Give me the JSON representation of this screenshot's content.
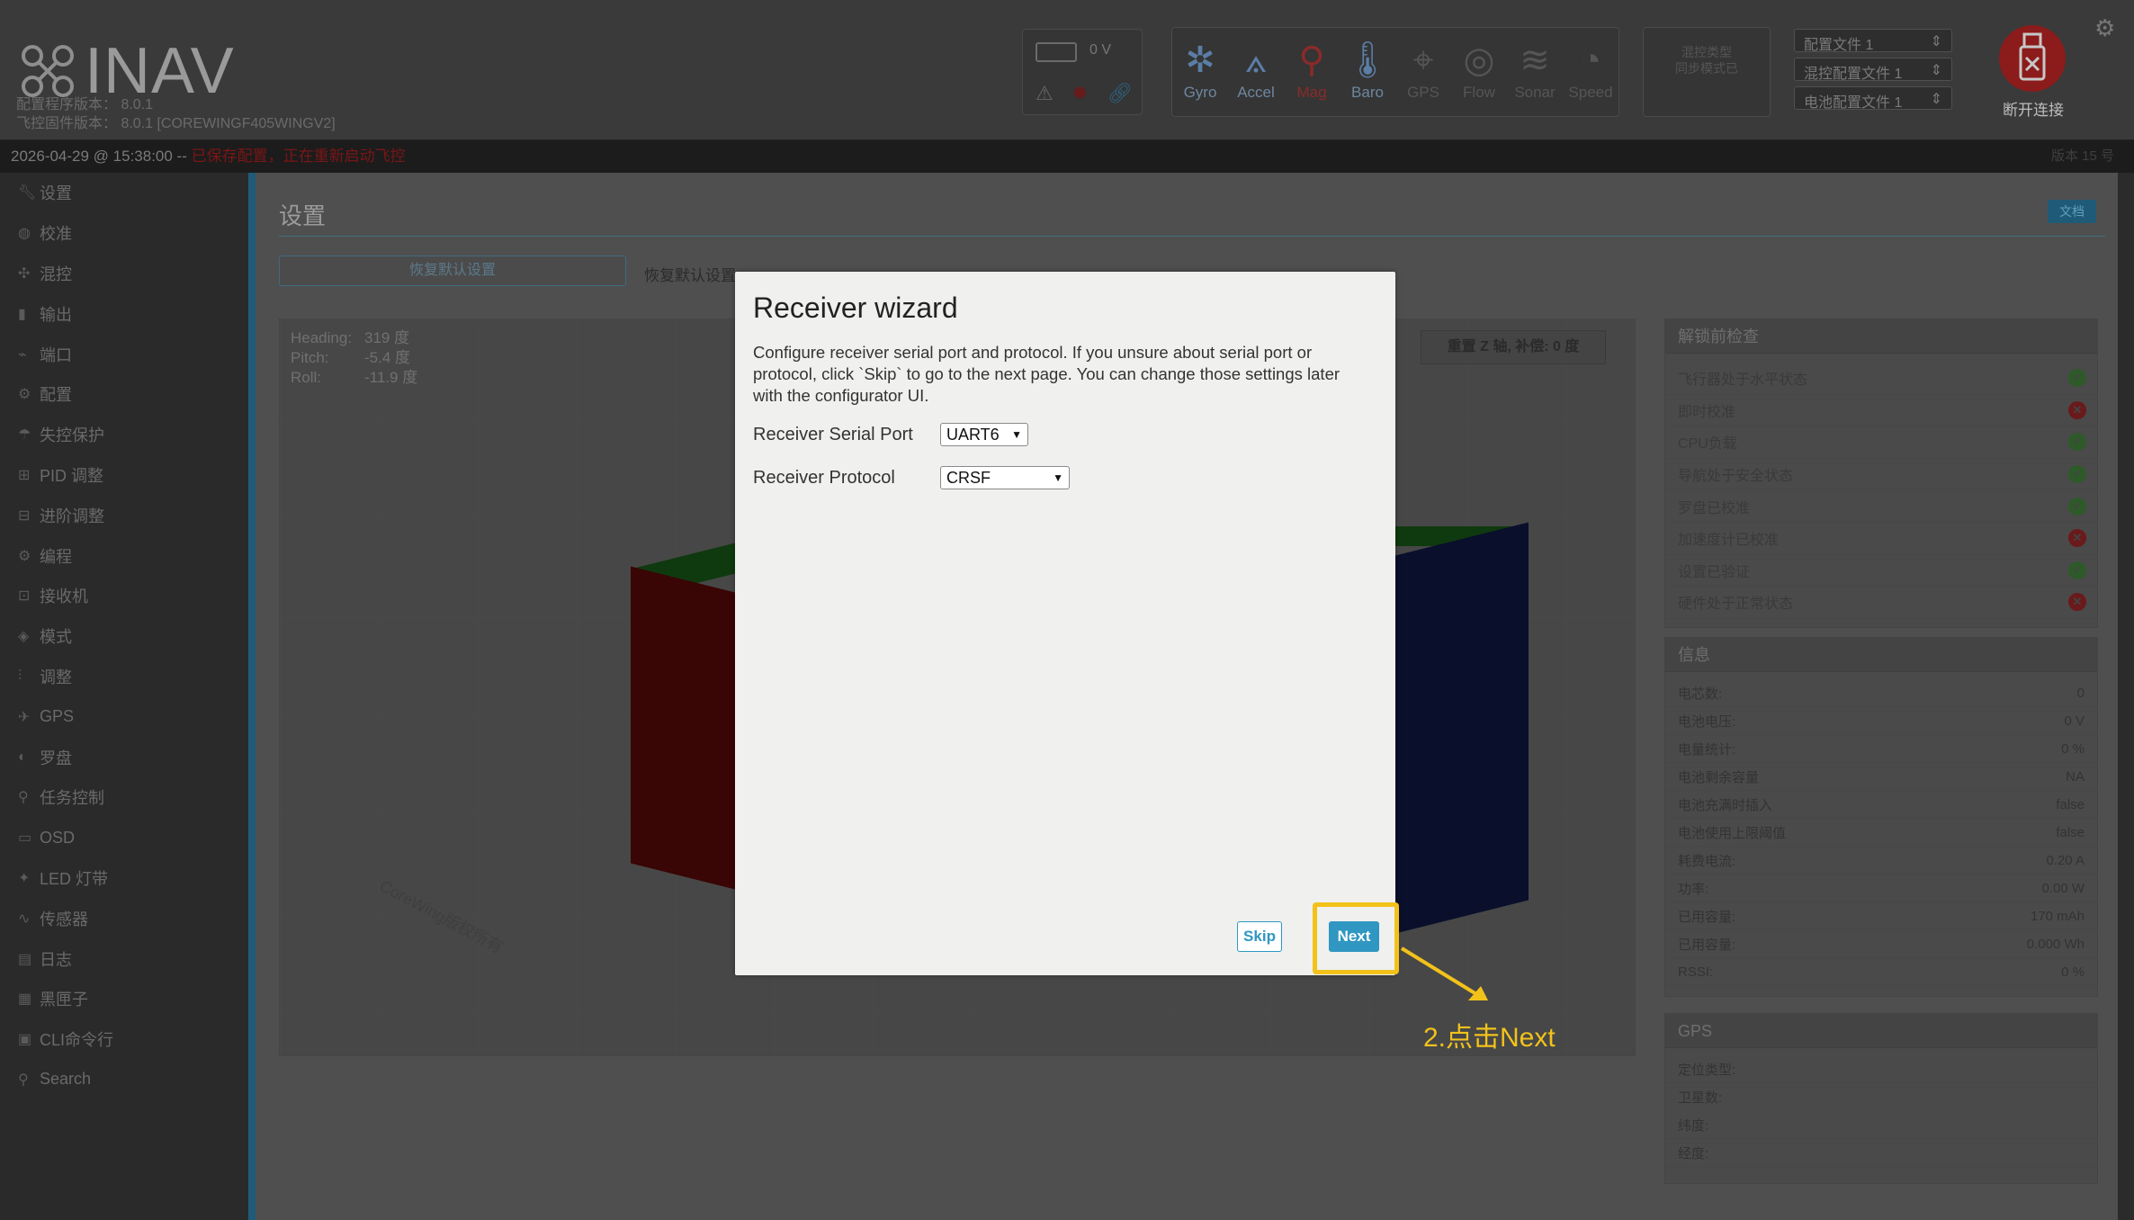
{
  "header": {
    "brand": "INAV",
    "fw_line1": "配置程序版本：  8.0.1",
    "fw_line2": "飞控固件版本：   8.0.1 [COREWINGF405WINGV2]",
    "battery_voltage": "0 V",
    "sensors": [
      {
        "label": "Gyro",
        "icon": "gyro-icon",
        "state": "ok"
      },
      {
        "label": "Accel",
        "icon": "accel-icon",
        "state": "ok"
      },
      {
        "label": "Mag",
        "icon": "mag-icon",
        "state": "error"
      },
      {
        "label": "Baro",
        "icon": "baro-icon",
        "state": "ok"
      },
      {
        "label": "GPS",
        "icon": "gps-icon",
        "state": "off"
      },
      {
        "label": "Flow",
        "icon": "flow-icon",
        "state": "off"
      },
      {
        "label": "Sonar",
        "icon": "sonar-icon",
        "state": "off"
      },
      {
        "label": "Speed",
        "icon": "speed-icon",
        "state": "off"
      }
    ],
    "mixer_note": "混控类型\n同步模式已",
    "profiles": [
      "配置文件 1",
      "混控配置文件 1",
      "电池配置文件 1"
    ],
    "disconnect_label": "断开连接"
  },
  "statusbar": {
    "timestamp": "2026-04-29 @ 15:38:00 -- ",
    "warning": "已保存配置，正在重新启动飞控",
    "right": "版本 15 号"
  },
  "sidebar": {
    "items": [
      {
        "label": "设置",
        "icon": "wrench-icon"
      },
      {
        "label": "校准",
        "icon": "calibrate-icon"
      },
      {
        "label": "混控",
        "icon": "mixer-icon"
      },
      {
        "label": "输出",
        "icon": "output-icon"
      },
      {
        "label": "端口",
        "icon": "ports-icon"
      },
      {
        "label": "配置",
        "icon": "config-gear-icon"
      },
      {
        "label": "失控保护",
        "icon": "failsafe-icon"
      },
      {
        "label": "PID 调整",
        "icon": "pid-icon"
      },
      {
        "label": "进阶调整",
        "icon": "advanced-tuning-icon"
      },
      {
        "label": "编程",
        "icon": "programming-icon"
      },
      {
        "label": "接收机",
        "icon": "receiver-icon"
      },
      {
        "label": "模式",
        "icon": "modes-icon"
      },
      {
        "label": "调整",
        "icon": "adjustments-icon"
      },
      {
        "label": "GPS",
        "icon": "gps-nav-icon"
      },
      {
        "label": "罗盘",
        "icon": "compass-icon"
      },
      {
        "label": "任务控制",
        "icon": "mission-icon"
      },
      {
        "label": "OSD",
        "icon": "osd-icon"
      },
      {
        "label": "LED 灯带",
        "icon": "led-icon"
      },
      {
        "label": "传感器",
        "icon": "sensors-icon"
      },
      {
        "label": "日志",
        "icon": "log-icon"
      },
      {
        "label": "黑匣子",
        "icon": "blackbox-icon"
      },
      {
        "label": "CLI命令行",
        "icon": "cli-icon"
      },
      {
        "label": "Search",
        "icon": "search-icon"
      }
    ]
  },
  "main": {
    "title": "设置",
    "badge": "文档",
    "reset_button": "恢复默认设置",
    "reset_text": "恢复默认设置",
    "attitude": {
      "heading_label": "Heading:",
      "heading": "319 度",
      "pitch_label": "Pitch:",
      "pitch": "-5.4 度",
      "roll_label": "Roll:",
      "roll": "-11.9 度"
    },
    "reset_z": "重置 Z 轴, 补偿: 0 度",
    "watermark": "CoreWing版权所有"
  },
  "prearm": {
    "title": "解锁前检查",
    "items": [
      {
        "label": "飞行器处于水平状态",
        "ok": true
      },
      {
        "label": "即时校准",
        "ok": false
      },
      {
        "label": "CPU负载",
        "ok": true
      },
      {
        "label": "导航处于安全状态",
        "ok": true
      },
      {
        "label": "罗盘已校准",
        "ok": true
      },
      {
        "label": "加速度计已校准",
        "ok": false
      },
      {
        "label": "设置已验证",
        "ok": true
      },
      {
        "label": "硬件处于正常状态",
        "ok": false
      }
    ]
  },
  "info": {
    "title": "信息",
    "rows": [
      {
        "k": "电芯数:",
        "v": "0"
      },
      {
        "k": "电池电压:",
        "v": "0 V"
      },
      {
        "k": "电量统计:",
        "v": "0 %"
      },
      {
        "k": "电池剩余容量",
        "v": "NA"
      },
      {
        "k": "电池充满时插入",
        "v": "false"
      },
      {
        "k": "电池使用上限阈值",
        "v": "false"
      },
      {
        "k": "耗费电流:",
        "v": "0.20 A"
      },
      {
        "k": "功率:",
        "v": "0.00 W"
      },
      {
        "k": "已用容量:",
        "v": "170 mAh"
      },
      {
        "k": "已用容量:",
        "v": "0.000 Wh"
      },
      {
        "k": "RSSI:",
        "v": "0 %"
      }
    ]
  },
  "gps": {
    "title": "GPS",
    "rows": [
      "定位类型:",
      "卫星数:",
      "纬度:",
      "经度:"
    ]
  },
  "wizard": {
    "title": "Receiver wizard",
    "description": "Configure receiver serial port and protocol. If you unsure about serial port or protocol, click `Skip` to go to the next page. You can change those settings later with the configurator UI.",
    "serial_port_label": "Receiver Serial Port",
    "serial_port_value": "UART6",
    "protocol_label": "Receiver Protocol",
    "protocol_value": "CRSF",
    "skip_label": "Skip",
    "next_label": "Next"
  },
  "annotation": {
    "text": "2.点击Next",
    "color": "#f2c21b"
  }
}
